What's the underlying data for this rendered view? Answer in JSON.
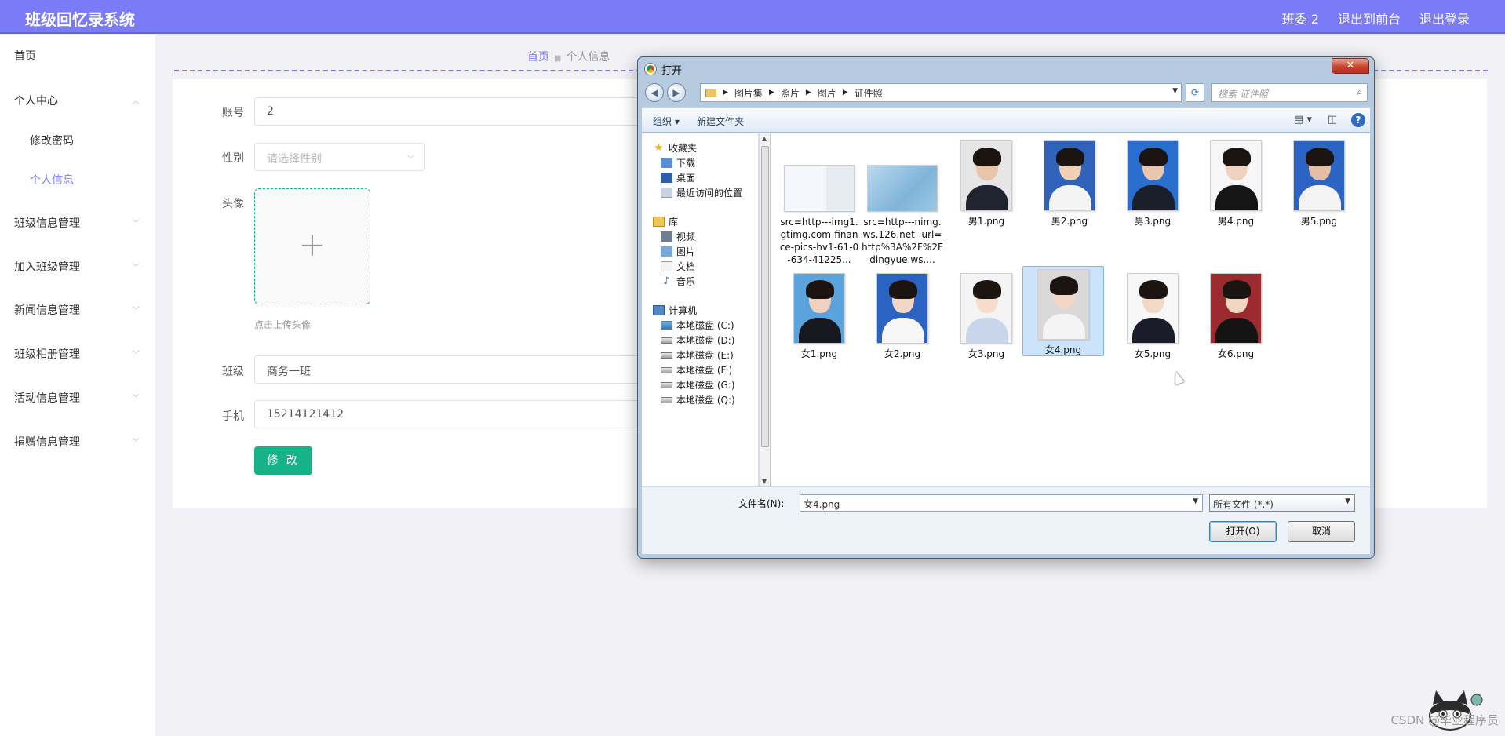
{
  "header": {
    "title": "班级回忆录系统",
    "user": "班委 2",
    "front_link": "退出到前台",
    "logout_link": "退出登录"
  },
  "sidebar": {
    "home": "首页",
    "personal_center": "个人中心",
    "change_password": "修改密码",
    "personal_info": "个人信息",
    "items": [
      "班级信息管理",
      "加入班级管理",
      "新闻信息管理",
      "班级相册管理",
      "活动信息管理",
      "捐赠信息管理"
    ]
  },
  "breadcrumb": {
    "home": "首页",
    "current": "个人信息"
  },
  "form": {
    "account_label": "账号",
    "account_value": "2",
    "gender_label": "性别",
    "gender_placeholder": "请选择性别",
    "avatar_label": "头像",
    "upload_tip": "点击上传头像",
    "class_label": "班级",
    "class_value": "商务一班",
    "phone_label": "手机",
    "phone_value": "15214121412",
    "submit_label": "修 改"
  },
  "dialog": {
    "title": "打开",
    "path": [
      "图片集",
      "照片",
      "图片",
      "证件照"
    ],
    "search_placeholder": "搜索 证件照",
    "organize": "组织",
    "new_folder": "新建文件夹",
    "nav": {
      "favorites": "收藏夹",
      "downloads": "下载",
      "desktop": "桌面",
      "recent": "最近访问的位置",
      "libraries": "库",
      "videos": "视频",
      "pictures": "图片",
      "documents": "文档",
      "music": "音乐",
      "computer": "计算机",
      "drives": [
        "本地磁盘 (C:)",
        "本地磁盘 (D:)",
        "本地磁盘 (E:)",
        "本地磁盘 (F:)",
        "本地磁盘 (G:)",
        "本地磁盘 (Q:)"
      ]
    },
    "files": [
      "src=http---img1.gtimg.com-finance-pics-hv1-61-0-634-41225...",
      "src=http---nimg.ws.126.net--url=http%3A%2F%2Fdingyue.ws....",
      "男1.png",
      "男2.png",
      "男3.png",
      "男4.png",
      "男5.png",
      "女1.png",
      "女2.png",
      "女3.png",
      "女4.png",
      "女5.png",
      "女6.png"
    ],
    "selected_file": "女4.png",
    "filename_label": "文件名(N):",
    "filename_value": "女4.png",
    "filetype_value": "所有文件 (*.*)",
    "open_button": "打开(O)",
    "cancel_button": "取消"
  },
  "watermark": "CSDN @毕业程序员"
}
